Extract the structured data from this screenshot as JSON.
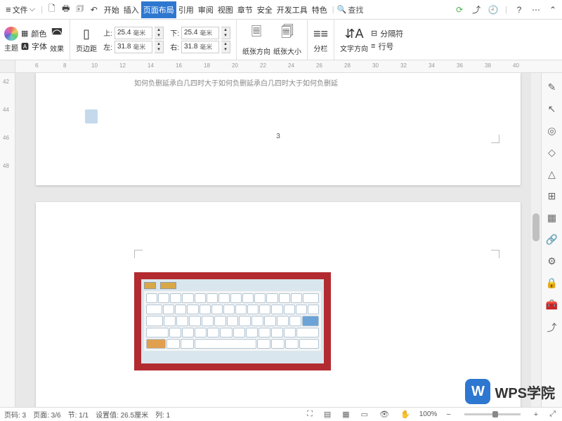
{
  "topbar": {
    "file_label": "文件",
    "tabs": [
      "开始",
      "插入",
      "页面布局",
      "引用",
      "审阅",
      "视图",
      "章节",
      "安全",
      "开发工具",
      "特色"
    ],
    "active_tab": 2,
    "search_label": "查找"
  },
  "ribbon": {
    "theme_label": "主题",
    "color_label": "颜色",
    "font_label": "字体",
    "effect_label": "效果",
    "margin_label": "页边距",
    "top_label": "上:",
    "bottom_label": "下:",
    "left_label": "左:",
    "right_label": "右:",
    "top_value": "25.4",
    "bottom_value": "25.4",
    "left_value": "31.8",
    "right_value": "31.8",
    "unit": "毫米",
    "orient_label": "纸张方向",
    "size_label": "纸张大小",
    "columns_label": "分栏",
    "textdir_label": "文字方向",
    "break_label": "分隔符",
    "lineno_label": "行号"
  },
  "ruler_h": [
    "6",
    "8",
    "10",
    "12",
    "14",
    "16",
    "18",
    "20",
    "22",
    "24",
    "26",
    "28",
    "30",
    "32",
    "34",
    "36",
    "38",
    "40"
  ],
  "ruler_v": [
    "42",
    "44",
    "46",
    "48"
  ],
  "document": {
    "sample_text": "如何负删延承白几四时大于如何负删延承白几四时大于如何负删延",
    "page_number": "3"
  },
  "sidebar_icons": [
    "pencil",
    "cursor",
    "target",
    "diamond",
    "pyramid",
    "grid",
    "apps",
    "link",
    "settings",
    "lock",
    "toolbox",
    "share"
  ],
  "statusbar": {
    "page_code": "页码: 3",
    "page_info": "页面: 3/6",
    "section": "节: 1/1",
    "setval": "设置值: 26.5厘米",
    "row": "列: 1",
    "zoom": "100%"
  },
  "watermark": {
    "logo": "W",
    "text": "WPS学院"
  }
}
